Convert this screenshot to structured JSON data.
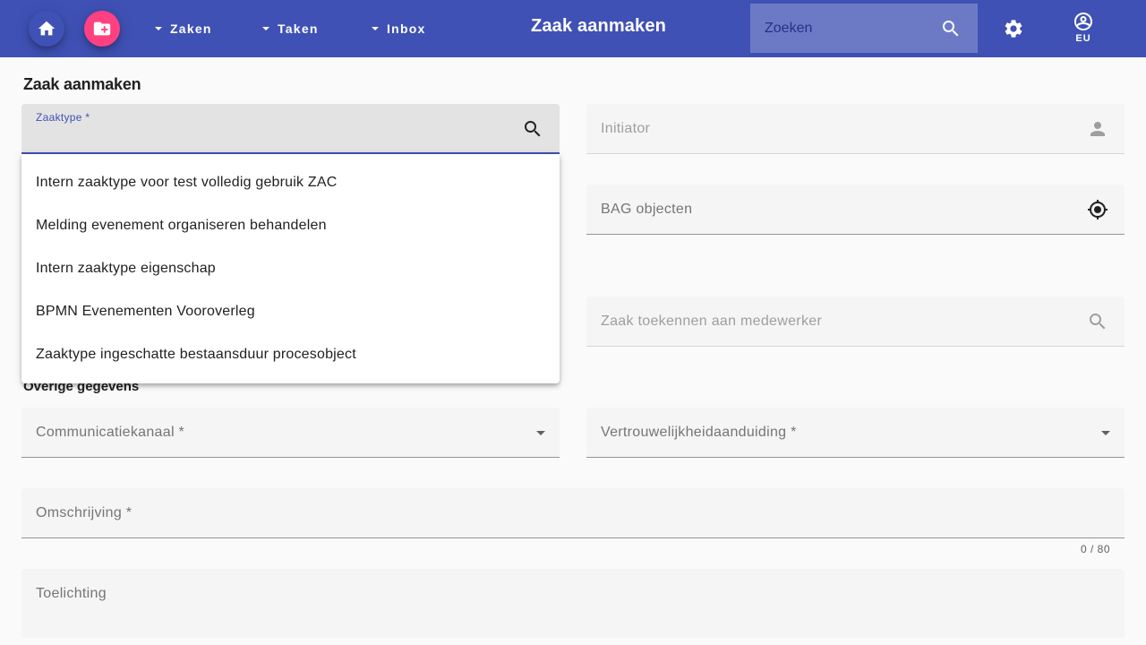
{
  "toolbar": {
    "menus": [
      {
        "label": "Zaken"
      },
      {
        "label": "Taken"
      },
      {
        "label": "Inbox"
      }
    ],
    "title": "Zaak aanmaken",
    "search_placeholder": "Zoeken",
    "user_initials": "EU",
    "colors": {
      "primary": "#3f51b5",
      "accent": "#ff4081"
    },
    "icons": [
      "home-icon",
      "create-folder-icon",
      "search-icon",
      "settings-icon",
      "account-circle-icon"
    ]
  },
  "page": {
    "title": "Zaak aanmaken",
    "section_other": "Overige gegevens"
  },
  "form": {
    "zaaktype_label": "Zaaktype *",
    "initiator_label": "Initiator",
    "bag_label": "BAG objecten",
    "toekennen_label": "Zaak toekennen aan medewerker",
    "communicatiekanaal_label": "Communicatiekanaal *",
    "vertrouwelijkheid_label": "Vertrouwelijkheidaanduiding *",
    "omschrijving_label": "Omschrijving *",
    "omschrijving_counter": "0 / 80",
    "toelichting_label": "Toelichting"
  },
  "zaaktype_options": [
    "Intern zaaktype voor test volledig gebruik ZAC",
    "Melding evenement organiseren behandelen",
    "Intern zaaktype eigenschap",
    "BPMN Evenementen Vooroverleg",
    "Zaaktype ingeschatte bestaansduur procesobject"
  ]
}
